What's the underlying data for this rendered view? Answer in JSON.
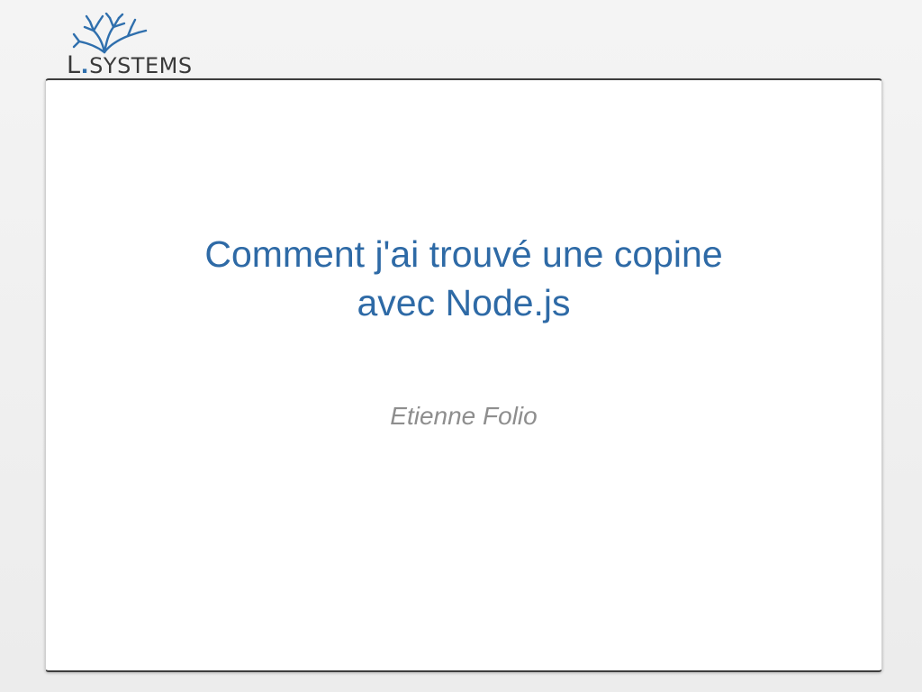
{
  "logo": {
    "prefix": "L",
    "dot": ".",
    "name": "SYSTEMS"
  },
  "slide": {
    "title_line1": "Comment j'ai trouvé une copine",
    "title_line2": "avec Node.js",
    "subtitle": "Etienne Folio"
  },
  "colors": {
    "accent": "#2f6fad",
    "title": "#2e6aa6",
    "subtitle": "#8e8e8e",
    "page_background": "#f0f0f0",
    "slide_background": "#ffffff",
    "slide_border": "#3d3d3d"
  }
}
